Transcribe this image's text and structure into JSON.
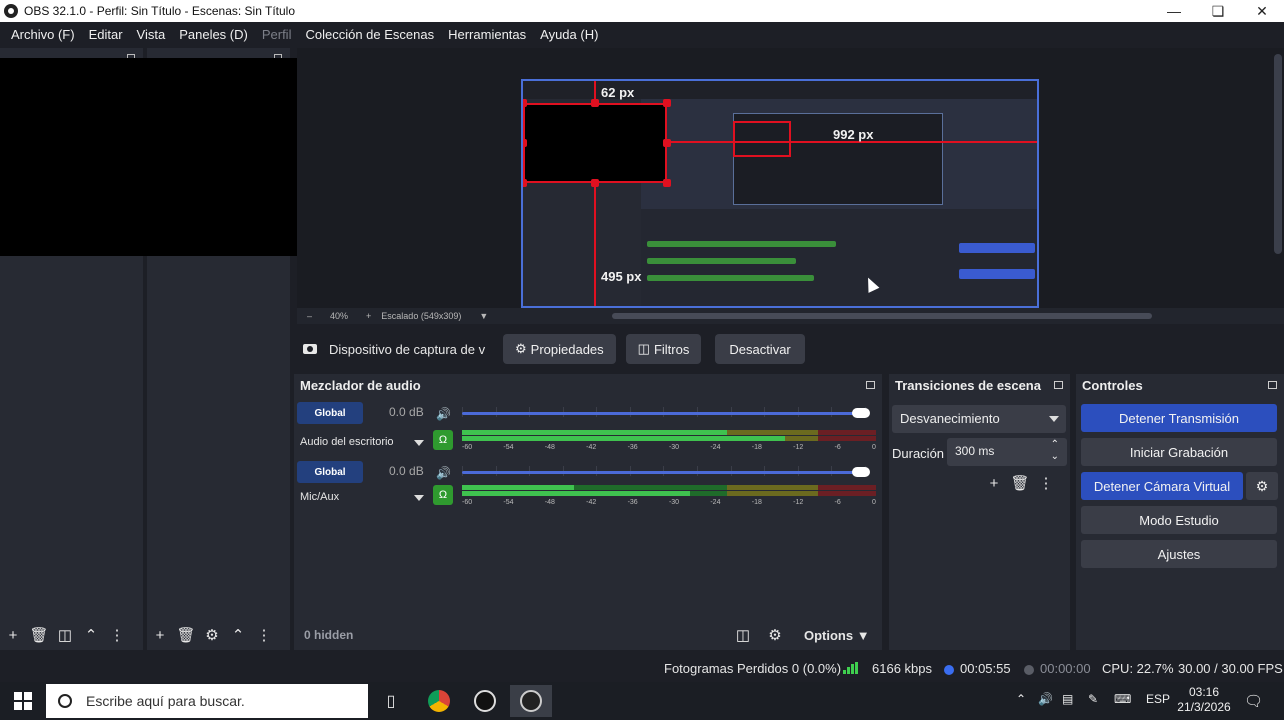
{
  "window": {
    "title": "OBS 32.1.0 - Perfil: Sin Título - Escenas: Sin Título"
  },
  "menu": {
    "items": [
      "Archivo (F)",
      "Editar",
      "Vista",
      "Paneles (D)",
      "Perfil",
      "Colección de Escenas",
      "Herramientas",
      "Ayuda (H)"
    ]
  },
  "preview": {
    "labels": {
      "top": "62 px",
      "right": "992 px",
      "bottom": "495 px"
    },
    "status": {
      "zoom": "40%",
      "scale": "Escalado (549x309)"
    }
  },
  "source_toolbar": {
    "source_name": "Dispositivo de captura de v",
    "properties": "Propiedades",
    "filters": "Filtros",
    "deactivate": "Desactivar"
  },
  "mixer": {
    "title": "Mezclador de audio",
    "tracks": [
      {
        "global_label": "Global",
        "db": "0.0 dB",
        "name": "Audio del escritorio",
        "level": 0.64,
        "peak": 0.78
      },
      {
        "global_label": "Global",
        "db": "0.0 dB",
        "name": "Mic/Aux",
        "level": 0.27,
        "peak": 0.55
      }
    ],
    "scale": [
      "-60",
      "-54",
      "-48",
      "-42",
      "-36",
      "-30",
      "-24",
      "-18",
      "-12",
      "-6",
      "0"
    ],
    "hidden_label": "0 hidden",
    "options_label": "Options"
  },
  "transitions": {
    "title": "Transiciones de escena",
    "selected": "Desvanecimiento",
    "duration_label": "Duración",
    "duration_value": "300 ms"
  },
  "controls": {
    "title": "Controles",
    "stop_stream": "Detener Transmisión",
    "start_record": "Iniciar Grabación",
    "stop_virtual_cam": "Detener Cámara Virtual",
    "studio_mode": "Modo Estudio",
    "settings": "Ajustes"
  },
  "statusbar": {
    "dropped_frames": "Fotogramas Perdidos 0 (0.0%)",
    "bitrate": "6166 kbps",
    "stream_time": "00:05:55",
    "record_time": "00:00:00",
    "cpu": "CPU: 22.7%",
    "fps": "30.00 / 30.00 FPS"
  },
  "taskbar": {
    "search_placeholder": "Escribe aquí para buscar.",
    "language": "ESP",
    "time": "03:16",
    "date": "21/3/2026"
  },
  "colors": {
    "accent_blue": "#2c4fbe",
    "selection_red": "#e01020",
    "meter_green": "#3fc24f"
  }
}
